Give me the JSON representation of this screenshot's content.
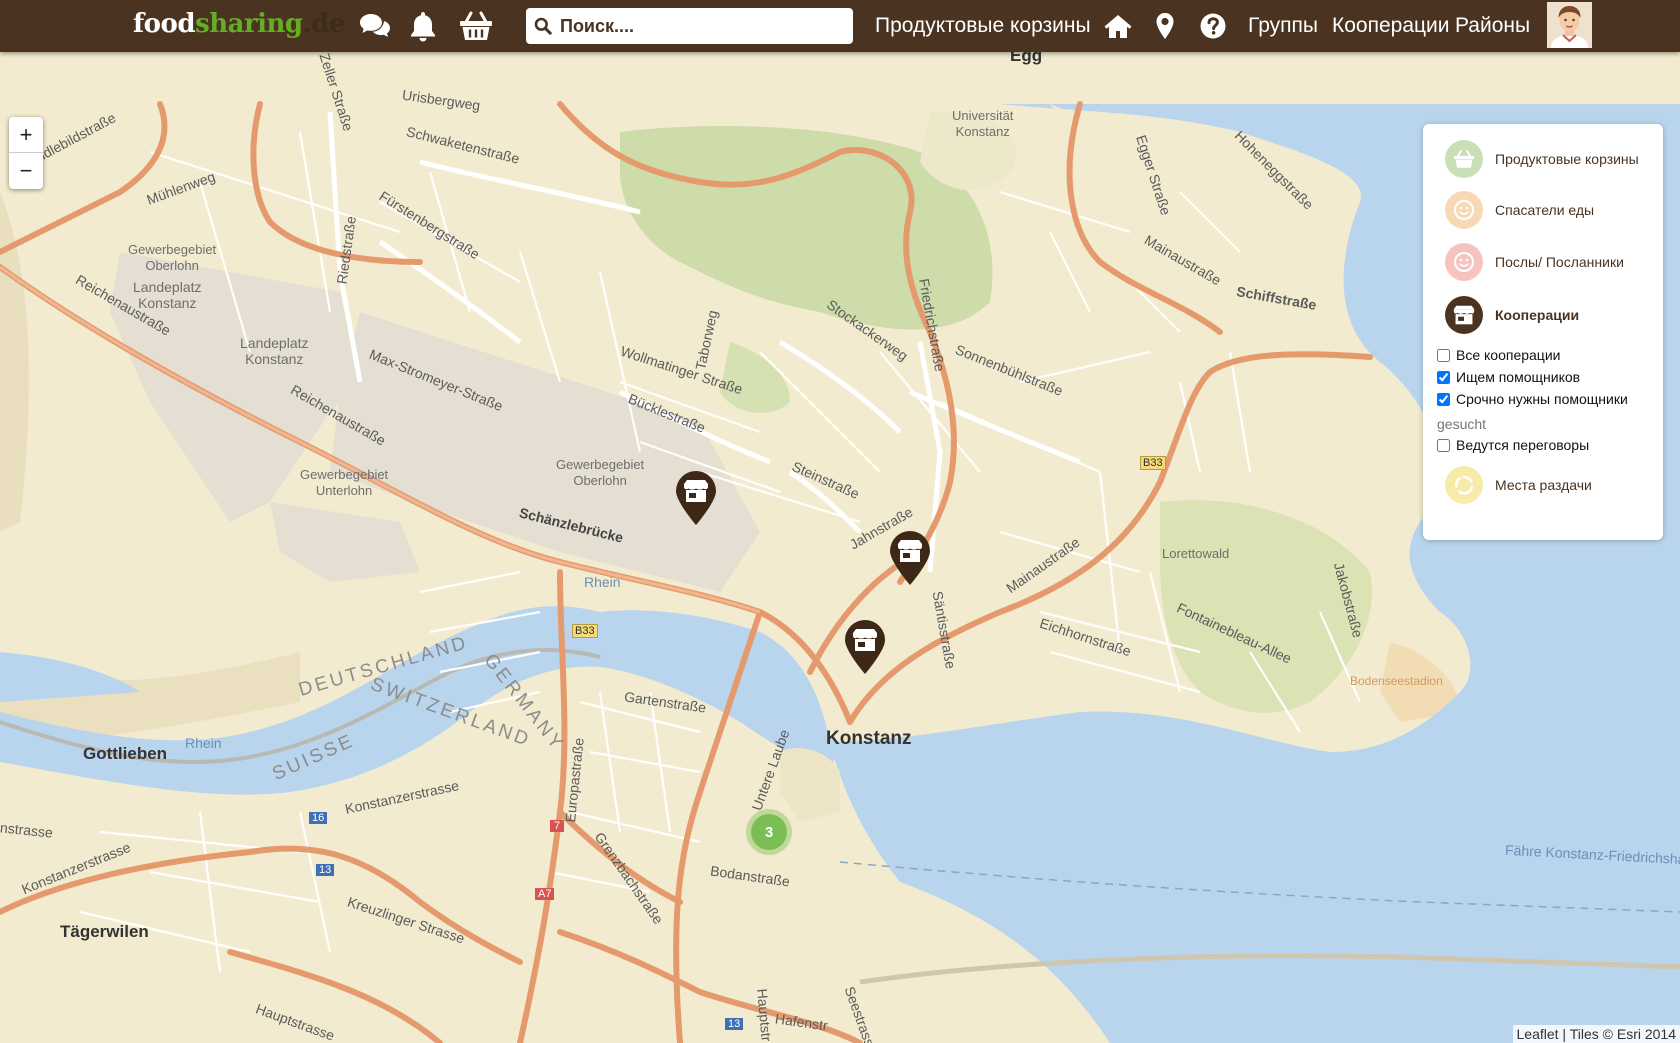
{
  "nav": {
    "logo": {
      "part1": "food",
      "part2": "sharing",
      "part3": ".de"
    },
    "search_placeholder": "Поиск....",
    "baskets_label": "Продуктовые корзины",
    "groups_label": "Группы",
    "cooperations_label": "Кооперации",
    "districts_label": "Районы",
    "icons": [
      "chat-icon",
      "bell-icon",
      "basket-icon",
      "home-icon",
      "map-pin-icon",
      "help-icon"
    ]
  },
  "map": {
    "zoom_in": "+",
    "zoom_out": "−",
    "attribution_leaflet": "Leaflet",
    "attribution_tiles": "Tiles © Esri 2014",
    "cluster_count": "3",
    "labels": {
      "egg": "Egg",
      "universitaet_1": "Universität",
      "universitaet_2": "Konstanz",
      "urisbergweg": "Urisbergweg",
      "schwaketenstrasse": "Schwaketenstraße",
      "muehlenweg": "Mühlenweg",
      "kindlebildstrasse": "Kindlebildstraße",
      "zellerstrasse": "Zeller Straße",
      "fuerstenbergstrasse": "Fürstenbergstraße",
      "riedstrasse": "Riedstraße",
      "reichenaustrasse_1": "Reichenaustraße",
      "reichenaustrasse_2": "Reichenaustraße",
      "gewerbegebiet_oberlohn_1": "Gewerbegebiet",
      "gewerbegebiet_oberlohn_2": "Oberlohn",
      "landeplatz_1": "Landeplatz",
      "landeplatz_2": "Konstanz",
      "landeplatz2_1": "Landeplatz",
      "landeplatz2_2": "Konstanz",
      "max_stromeyer": "Max-Stromeyer-Straße",
      "gewerbegebiet_unterlohn_1": "Gewerbegebiet",
      "gewerbegebiet_unterlohn_2": "Unterlohn",
      "taborweg": "Taborweg",
      "wollmatinger": "Wollmatinger Straße",
      "buecklestrasse": "Bücklestraße",
      "gewerbegebiet_oberlohn2_1": "Gewerbegebiet",
      "gewerbegebiet_oberlohn2_2": "Oberlohn",
      "stockackerweg": "Stockackerweg",
      "friedrichstrasse": "Friedrichstraße",
      "sonnenbuehlstrasse": "Sonnenbühlstraße",
      "steinstrasse": "Steinstraße",
      "eggerstrasse": "Egger Straße",
      "hoheneggstrasse": "Hoheneggstraße",
      "mainaustrasse_1": "Mainaustraße",
      "mainaustrasse_2": "Mainaustraße",
      "schiffstrasse": "Schiffstraße",
      "b33_1": "B33",
      "b33_2": "B33",
      "schaenzlebruecke": "Schänzlebrücke",
      "rhein_1": "Rhein",
      "rhein_2": "Rhein",
      "jahnstrasse": "Jahnstraße",
      "saentisstrasse": "Säntisstraße",
      "lorettowald": "Lorettowald",
      "eichhornstrasse": "Eichhornstraße",
      "fontainebleau": "Fontainebleau-Allee",
      "jakobstrasse": "Jakobstraße",
      "bodenseestadion": "Bodenseestadion",
      "deutschland": "DEUTSCHLAND",
      "germany": "GERMANY",
      "suisse": "SUISSE",
      "switzerland": "SWITZERLAND",
      "gartenstrasse": "Gartenstraße",
      "europastrasse": "Europastraße",
      "untere_laube": "Untere Laube",
      "konstanz": "Konstanz",
      "gottlieben": "Gottlieben",
      "konstanzerstrasse_1": "Konstanzerstrasse",
      "konstanzerstrasse_2": "Konstanzerstrasse",
      "strasse_left": "nstrasse",
      "grenzbachstrasse": "Grenzbachstraße",
      "bodanstrasse": "Bodanstraße",
      "kreuzlinger": "Kreuzlinger Strasse",
      "taegerwilen": "Tägerwilen",
      "hauptstrasse_1": "Hauptstrasse",
      "hauptstrasse_2": "Hauptstr",
      "hafenstrasse": "Hafenstr",
      "seestrasse": "Seestrasse",
      "faehre": "Fähre Konstanz-Friedrichshafen",
      "shield_16": "16",
      "shield_13a": "13",
      "shield_13b": "13",
      "shield_7": "7",
      "shield_a7": "A7"
    }
  },
  "legend": {
    "baskets": "Продуктовые корзины",
    "foodsavers": "Спасатели еды",
    "ambassadors": "Послы/ Посланники",
    "cooperations": "Кооперации",
    "all_cooperations": "Все кооперации",
    "seeking_helpers": "Ищем помощников",
    "urgent_helpers": "Срочно нужны помощники",
    "gesucht": "gesucht",
    "negotiations": "Ведутся переговоры",
    "fairteiler": "Места раздачи",
    "checks": {
      "all": false,
      "seeking": true,
      "urgent": true,
      "negotiations": false
    },
    "colors": {
      "baskets": "#c9dfb5",
      "foodsavers": "#f7d9b6",
      "ambassadors": "#f6c4c0",
      "cooperations": "#4a3320",
      "fairteiler": "#f7ebaa"
    }
  }
}
